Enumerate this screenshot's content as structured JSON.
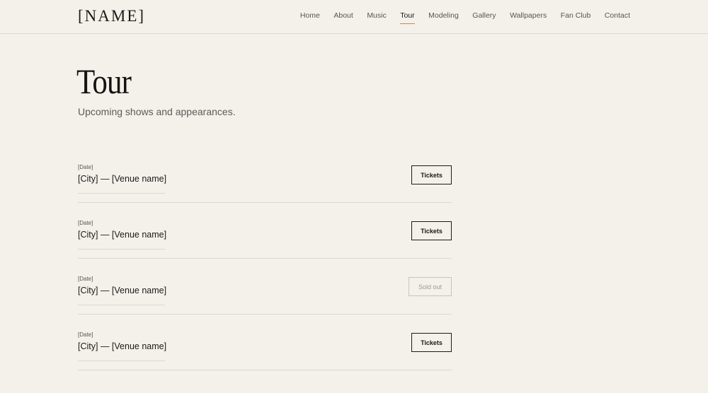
{
  "header": {
    "logo": "[NAME]",
    "nav": [
      {
        "label": "Home",
        "active": false
      },
      {
        "label": "About",
        "active": false
      },
      {
        "label": "Music",
        "active": false
      },
      {
        "label": "Tour",
        "active": true
      },
      {
        "label": "Modeling",
        "active": false
      },
      {
        "label": "Gallery",
        "active": false
      },
      {
        "label": "Wallpapers",
        "active": false
      },
      {
        "label": "Fan Club",
        "active": false
      },
      {
        "label": "Contact",
        "active": false
      }
    ]
  },
  "hero": {
    "title": "Tour",
    "subtitle": "Upcoming shows and appearances."
  },
  "shows": [
    {
      "date": "[Date]",
      "place": "[City] — [Venue name]",
      "button": "Tickets",
      "status": "available"
    },
    {
      "date": "[Date]",
      "place": "[City] — [Venue name]",
      "button": "Tickets",
      "status": "available"
    },
    {
      "date": "[Date]",
      "place": "[City] — [Venue name]",
      "button": "Sold out",
      "status": "soldout"
    },
    {
      "date": "[Date]",
      "place": "[City] — [Venue name]",
      "button": "Tickets",
      "status": "available"
    }
  ],
  "colors": {
    "background": "#f4f1ea",
    "text": "#1a1a1a",
    "accent_underline": "#c78a55",
    "divider": "#dcd8cf"
  }
}
